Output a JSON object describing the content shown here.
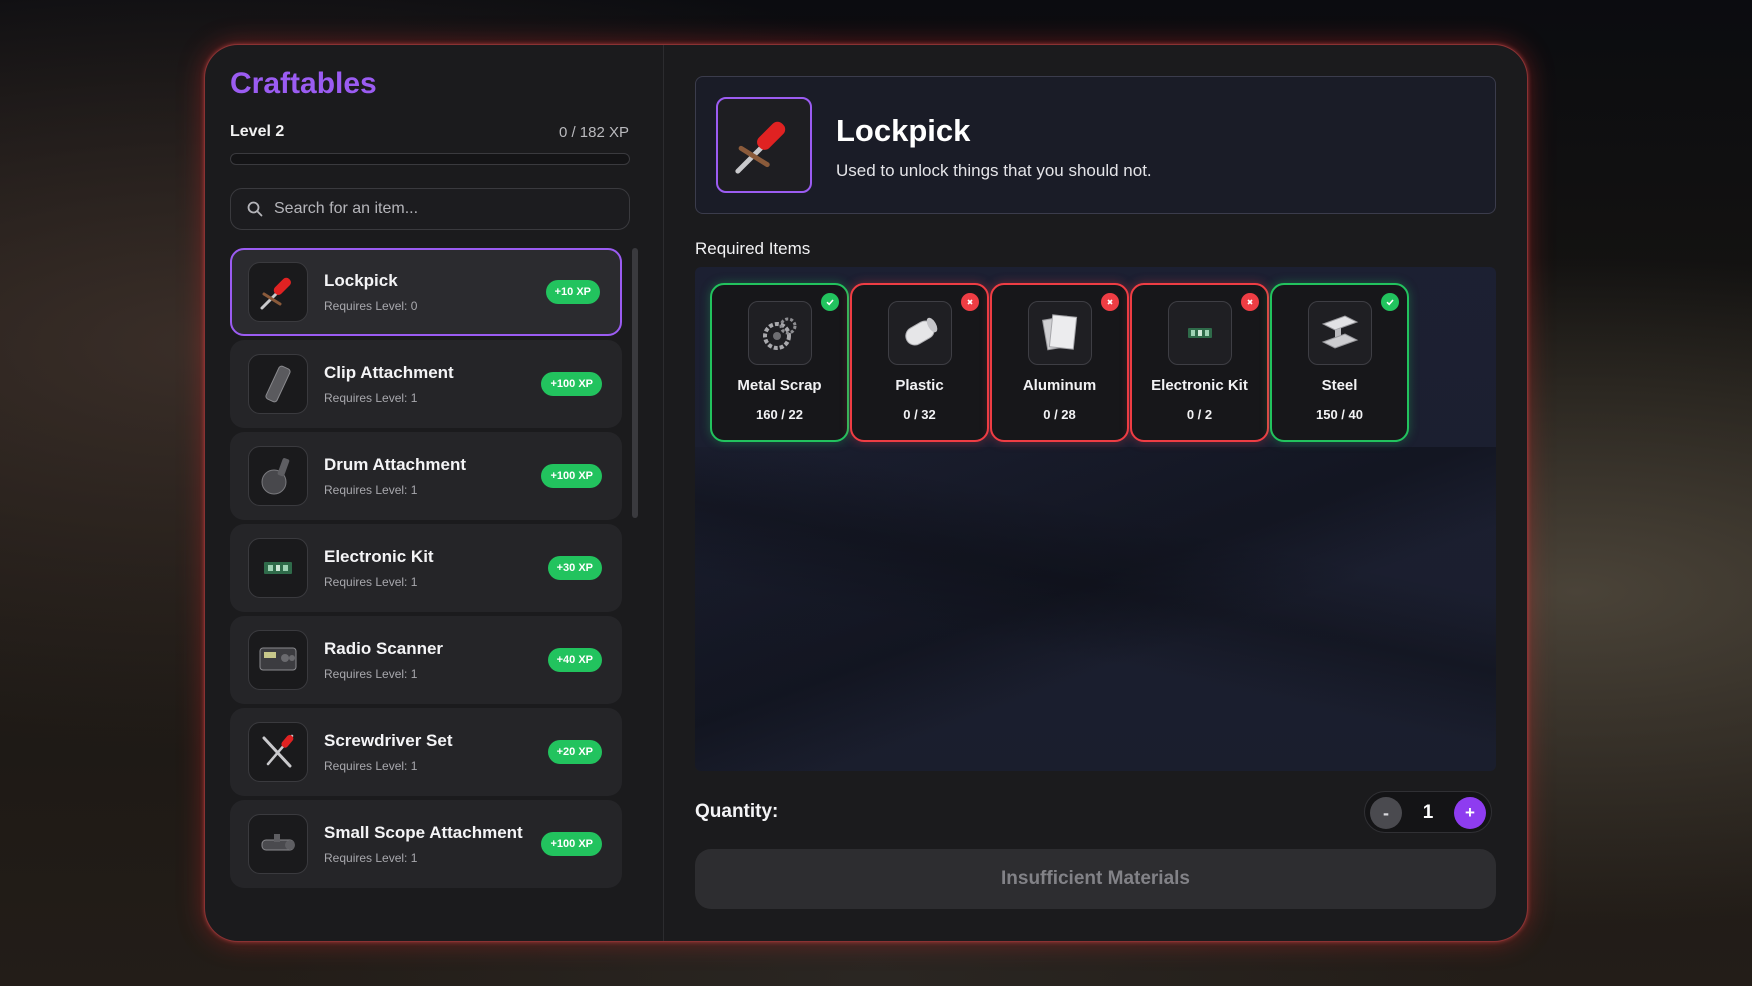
{
  "sidebar": {
    "title": "Craftables",
    "level_label": "Level 2",
    "xp_text": "0 / 182 XP",
    "xp_progress_fraction": 0.0,
    "search": {
      "placeholder": "Search for an item..."
    },
    "items": [
      {
        "name": "Lockpick",
        "requirement": "Requires Level: 0",
        "xp": "+10 XP",
        "icon": "lockpick-icon",
        "selected": true
      },
      {
        "name": "Clip Attachment",
        "requirement": "Requires Level: 1",
        "xp": "+100 XP",
        "icon": "clip-attachment-icon",
        "selected": false
      },
      {
        "name": "Drum Attachment",
        "requirement": "Requires Level: 1",
        "xp": "+100 XP",
        "icon": "drum-attachment-icon",
        "selected": false
      },
      {
        "name": "Electronic Kit",
        "requirement": "Requires Level: 1",
        "xp": "+30 XP",
        "icon": "electronic-kit-icon",
        "selected": false
      },
      {
        "name": "Radio Scanner",
        "requirement": "Requires Level: 1",
        "xp": "+40 XP",
        "icon": "radio-scanner-icon",
        "selected": false
      },
      {
        "name": "Screwdriver Set",
        "requirement": "Requires Level: 1",
        "xp": "+20 XP",
        "icon": "screwdriver-set-icon",
        "selected": false
      },
      {
        "name": "Small Scope Attachment",
        "requirement": "Requires Level: 1",
        "xp": "+100 XP",
        "icon": "scope-attachment-icon",
        "selected": false
      }
    ]
  },
  "detail": {
    "name": "Lockpick",
    "description": "Used to unlock things that you should not.",
    "icon": "lockpick-icon",
    "required_label": "Required Items",
    "materials": [
      {
        "name": "Metal Scrap",
        "count": "160 / 22",
        "status": "ok",
        "icon": "metal-scrap-icon"
      },
      {
        "name": "Plastic",
        "count": "0 / 32",
        "status": "missing",
        "icon": "plastic-icon"
      },
      {
        "name": "Aluminum",
        "count": "0 / 28",
        "status": "missing",
        "icon": "aluminum-icon"
      },
      {
        "name": "Electronic Kit",
        "count": "0 / 2",
        "status": "missing",
        "icon": "electronic-kit-icon"
      },
      {
        "name": "Steel",
        "count": "150 / 40",
        "status": "ok",
        "icon": "steel-icon"
      }
    ],
    "quantity_label": "Quantity:",
    "quantity_value": "1",
    "minus_label": "-",
    "plus_label": "+",
    "craft_button_label": "Insufficient Materials"
  },
  "colors": {
    "accent": "#9b5cf2",
    "ok": "#22c35e",
    "missing": "#ef3d44",
    "panel_glow": "#e64646"
  }
}
